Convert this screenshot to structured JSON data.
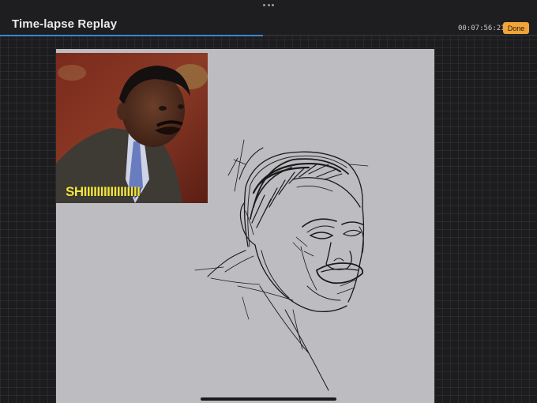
{
  "header": {
    "more_icon": "ellipsis-icon",
    "title": "Time-lapse Replay",
    "elapsed_time": "00:07:56:21",
    "done_label": "Done",
    "accent_color": "#f0a43a",
    "progress_color": "#3a84d6",
    "progress_fraction": 0.49
  },
  "canvas": {
    "reference_image": {
      "caption": "SHIIIIIIIIIIIIIIIII"
    },
    "background_color": "#bdbcc1"
  }
}
